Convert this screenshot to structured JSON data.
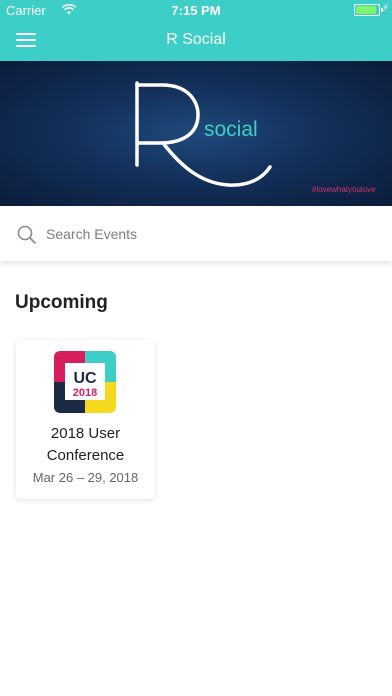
{
  "status_bar": {
    "carrier": "Carrier",
    "time": "7:15 PM",
    "icons": [
      "wifi-icon",
      "battery-icon",
      "charging-bolt-icon"
    ]
  },
  "nav": {
    "title": "R Social",
    "menu_icon": "hamburger-menu-icon"
  },
  "hero": {
    "logo_letter": "R",
    "logo_word": "social",
    "hashtag": "#lovewhatyoulove"
  },
  "search": {
    "placeholder": "Search Events",
    "value": ""
  },
  "section": {
    "title": "Upcoming"
  },
  "events": [
    {
      "logo_text": "UC",
      "logo_year": "2018",
      "name_line1": "2018 User",
      "name_line2": "Conference",
      "dates": "Mar 26 – 29, 2018"
    }
  ],
  "colors": {
    "brand_teal": "#3dcfc7",
    "hero_navy": "#13305a",
    "logo_pink": "#d81f5d",
    "logo_yellow": "#f5d91f",
    "logo_dark": "#1d2a44"
  }
}
